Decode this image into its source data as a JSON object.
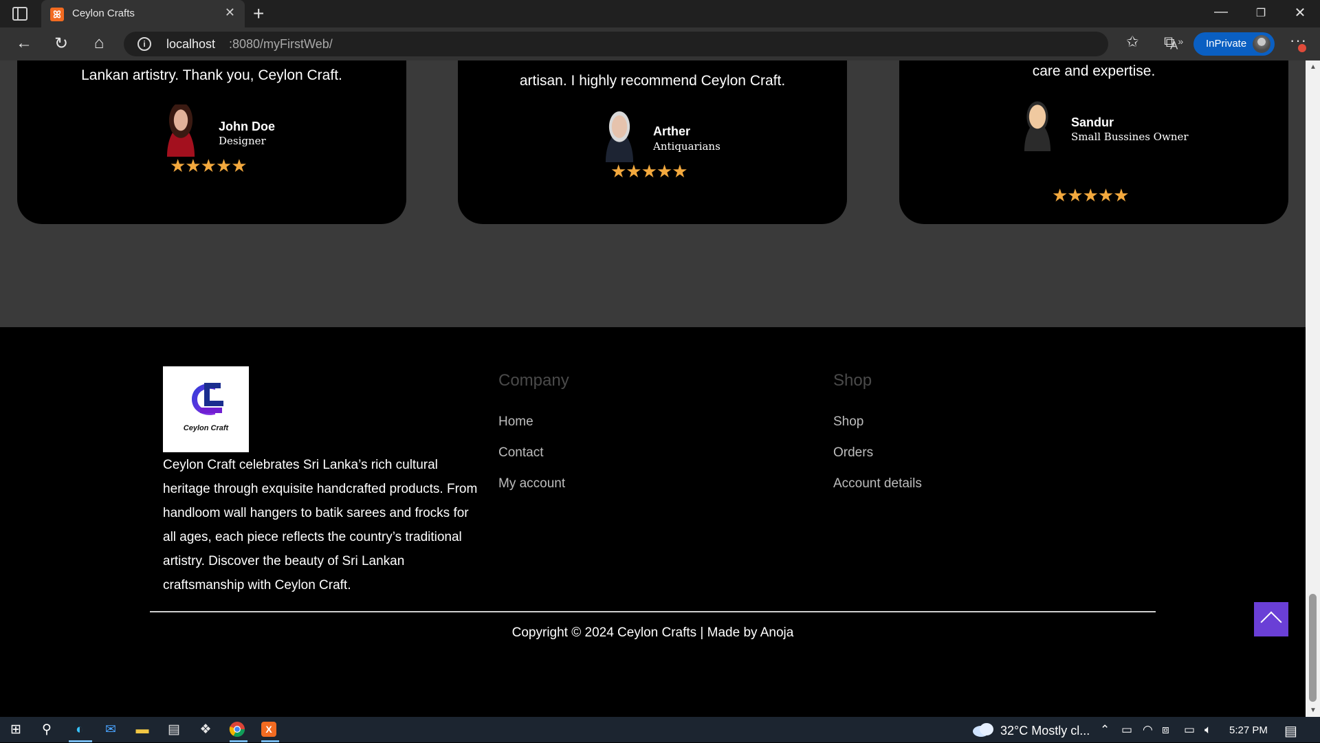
{
  "browser": {
    "tab_title": "Ceylon Crafts",
    "url_host": "localhost",
    "url_path": ":8080/myFirstWeb/",
    "inprivate_label": "InPrivate"
  },
  "testimonials": [
    {
      "quote_tail": "Lankan artistry. Thank you, Ceylon Craft.",
      "name": "John Doe",
      "role": "Designer",
      "stars": "★★★★★",
      "rating": 5
    },
    {
      "quote_tail": "artisan. I highly recommend Ceylon Craft.",
      "name": "Arther",
      "role": "Antiquarians",
      "stars": "★★★★★",
      "rating": 5
    },
    {
      "quote_tail": "care and expertise.",
      "name": "Sandur",
      "role": "Small Bussines Owner",
      "stars": "★★★★★",
      "rating": 5
    }
  ],
  "footer": {
    "logo_text": "Ceylon Craft",
    "about": "Ceylon Craft celebrates Sri Lanka’s rich cultural heritage through exquisite handcrafted products. From handloom wall hangers to batik sarees and frocks for all ages, each piece reflects the country’s traditional artistry. Discover the beauty of Sri Lankan craftsmanship with Ceylon Craft.",
    "company": {
      "title": "Company",
      "links": [
        "Home",
        "Contact",
        "My account"
      ]
    },
    "shop": {
      "title": "Shop",
      "links": [
        "Shop",
        "Orders",
        "Account details"
      ]
    },
    "copyright": "Copyright © 2024 Ceylon Crafts | Made by Anoja"
  },
  "taskbar": {
    "weather": "32°C  Mostly cl...",
    "time": "5:27 PM"
  },
  "colors": {
    "accent_purple": "#6a3fd6",
    "star_orange": "#f3a93e",
    "inprivate_blue": "#0a5fc2"
  },
  "icons": [
    "tab-actions-icon",
    "back-arrow-icon",
    "reload-icon",
    "home-icon",
    "info-icon",
    "read-aloud-icon",
    "favorite-star-icon",
    "favorites-icon",
    "collections-icon",
    "more-icon",
    "arrow-up-icon",
    "windows-start-icon",
    "search-icon",
    "edge-icon",
    "mail-icon",
    "folder-icon",
    "store-icon",
    "dropbox-icon",
    "chrome-icon",
    "xampp-icon",
    "weather-cloud-icon",
    "wifi-icon",
    "battery-icon",
    "volume-icon",
    "notification-icon"
  ]
}
